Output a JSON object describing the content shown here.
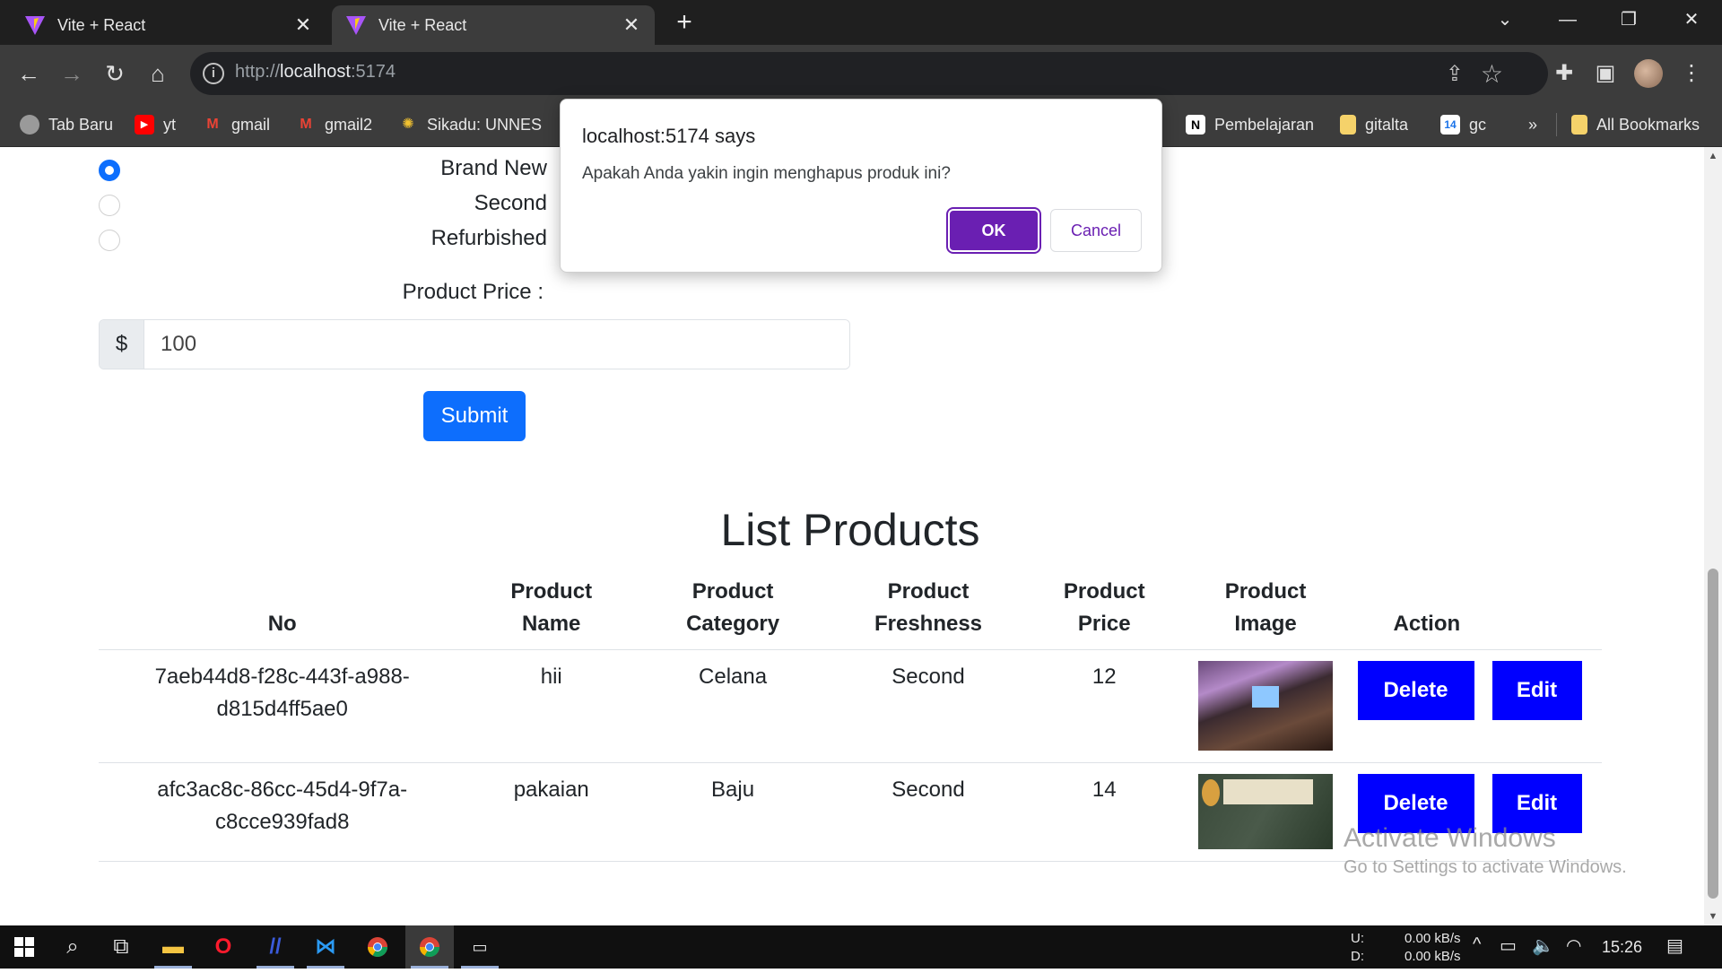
{
  "browser": {
    "tabs": [
      {
        "title": "Vite + React",
        "active": false
      },
      {
        "title": "Vite + React",
        "active": true
      }
    ],
    "url_scheme": "http://",
    "url_host": "localhost",
    "url_port": ":5174",
    "bookmarks": [
      {
        "label": "Tab Baru",
        "icon": "globe-icon"
      },
      {
        "label": "yt",
        "icon": "youtube-icon"
      },
      {
        "label": "gmail",
        "icon": "gmail-icon"
      },
      {
        "label": "gmail2",
        "icon": "gmail-icon"
      },
      {
        "label": "Sikadu: UNNES",
        "icon": "unnes-icon"
      },
      {
        "label": "Pembelajaran",
        "icon": "notion-icon"
      },
      {
        "label": "gitalta",
        "icon": "folder-icon"
      },
      {
        "label": "gc",
        "icon": "calendar-icon"
      },
      {
        "label": "All Bookmarks",
        "icon": "folder-icon"
      }
    ],
    "calendar_day": "14",
    "overflow": "»"
  },
  "form": {
    "freshness_options": [
      {
        "label": "Brand New",
        "checked": true
      },
      {
        "label": "Second",
        "checked": false
      },
      {
        "label": "Refurbished",
        "checked": false
      }
    ],
    "price_label": "Product Price :",
    "currency_symbol": "$",
    "price_value": "100",
    "submit_label": "Submit"
  },
  "list": {
    "title": "List Products",
    "headers": {
      "no": "No",
      "name": "Product Name",
      "category": "Product Category",
      "freshness": "Product Freshness",
      "price": "Product Price",
      "image": "Product Image",
      "action": "Action"
    },
    "rows": [
      {
        "id": "7aeb44d8-f28c-443f-a988-d815d4ff5ae0",
        "name": "hii",
        "category": "Celana",
        "freshness": "Second",
        "price": "12",
        "delete": "Delete",
        "edit": "Edit"
      },
      {
        "id": "afc3ac8c-86cc-45d4-9f7a-c8cce939fad8",
        "name": "pakaian",
        "category": "Baju",
        "freshness": "Second",
        "price": "14",
        "delete": "Delete",
        "edit": "Edit"
      }
    ]
  },
  "dialog": {
    "origin": "localhost:5174 says",
    "message": "Apakah Anda yakin ingin menghapus produk ini?",
    "ok_label": "OK",
    "cancel_label": "Cancel"
  },
  "watermark": {
    "line1": "Activate Windows",
    "line2": "Go to Settings to activate Windows."
  },
  "taskbar": {
    "upload_label": "U:",
    "download_label": "D:",
    "upload_speed": "0.00 kB/s",
    "download_speed": "0.00 kB/s",
    "time": "15:26"
  },
  "colors": {
    "primary": "#0d6efd",
    "action_button": "#0000ff",
    "dialog_accent": "#6a1fb2"
  }
}
